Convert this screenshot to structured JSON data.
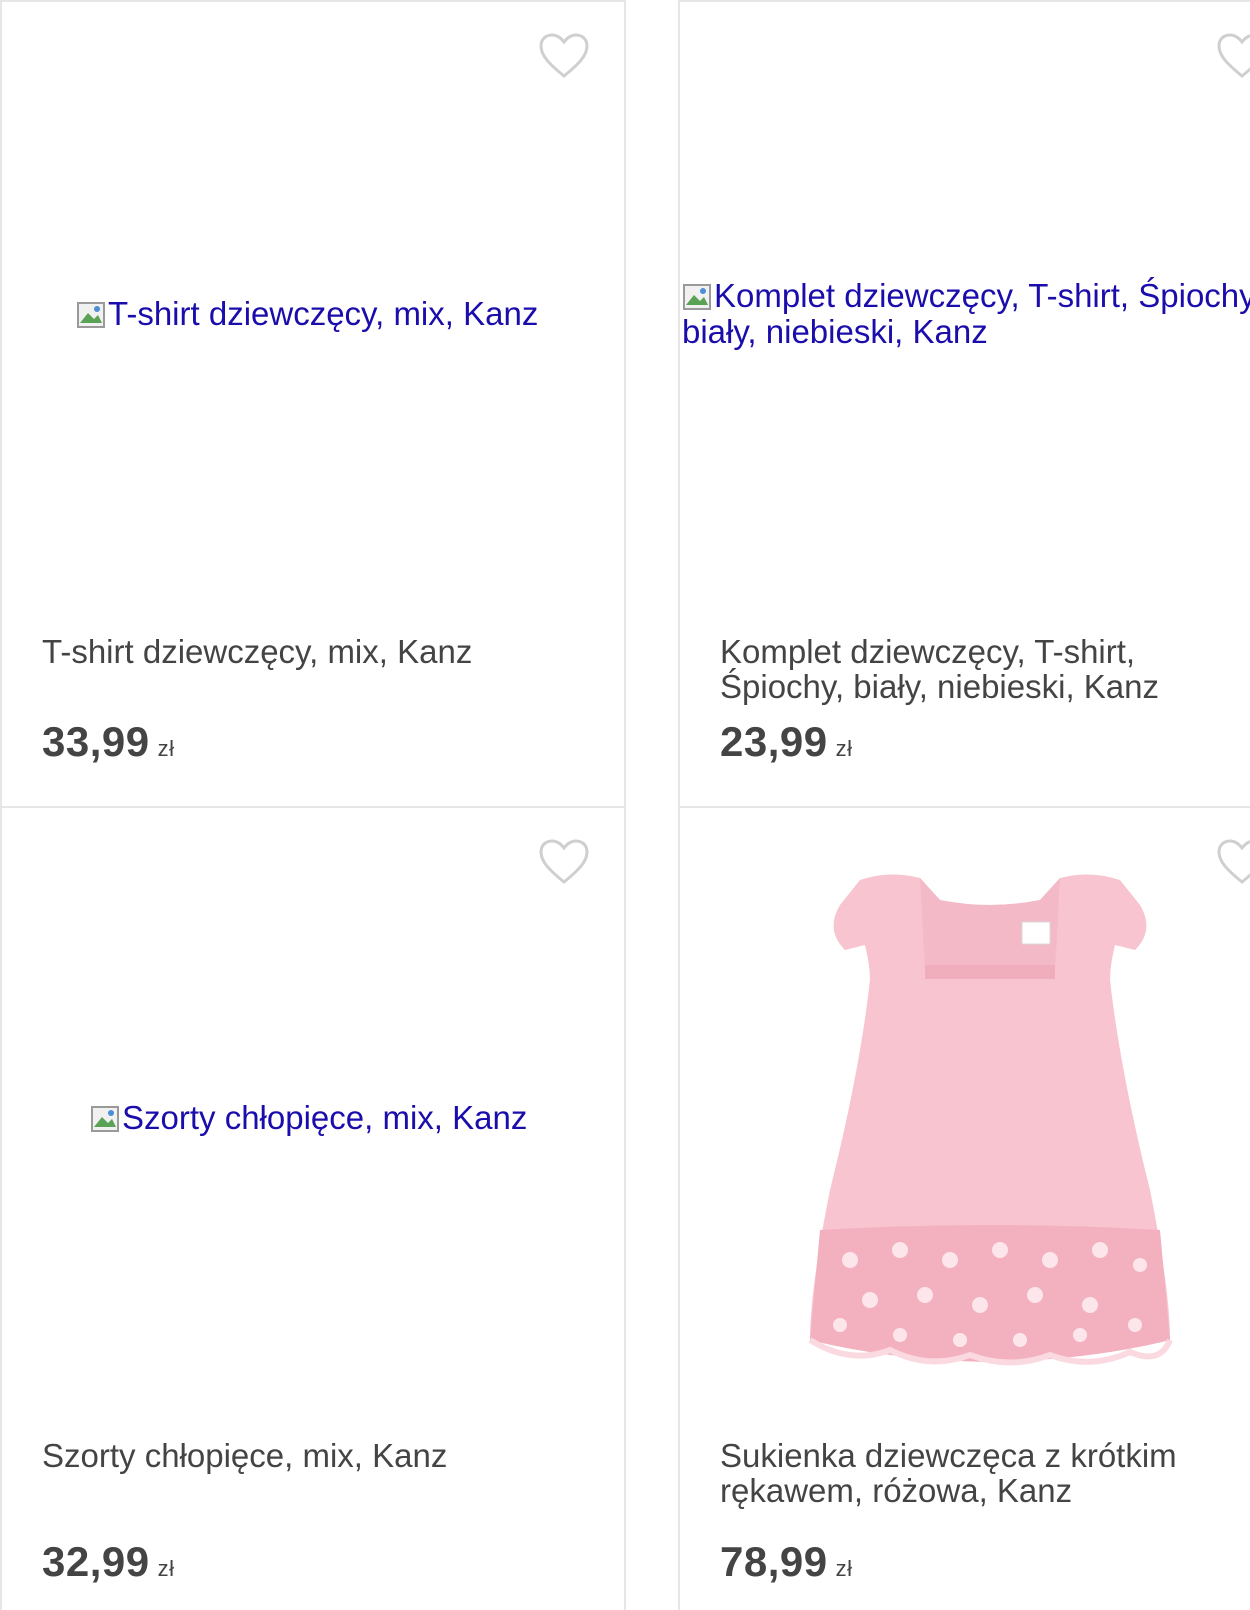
{
  "products": [
    {
      "title": "T-shirt dziewczęcy, mix, Kanz",
      "image_alt": "T-shirt dziewczęcy, mix, Kanz",
      "price": "33,99",
      "currency": "zł"
    },
    {
      "title": "Komplet dziewczęcy, T-shirt, Śpiochy, biały, niebieski, Kanz",
      "image_alt": "Komplet dziewczęcy, T-shirt, Śpiochy, biały, niebieski, Kanz",
      "price": "23,99",
      "currency": "zł"
    },
    {
      "title": "Szorty chłopięce, mix, Kanz",
      "image_alt": "Szorty chłopięce, mix, Kanz",
      "price": "32,99",
      "currency": "zł"
    },
    {
      "title": "Sukienka dziewczęca z krótkim rękawem, różowa, Kanz",
      "image_alt": "",
      "price": "78,99",
      "currency": "zł"
    }
  ],
  "icons": {
    "favorite": "heart-outline-icon",
    "broken_image": "broken-image-icon"
  },
  "colors": {
    "text": "#444444",
    "link": "#1a0dab",
    "border": "#e6e6e6",
    "heart": "#cfcfcf",
    "dress": "#f7c4cf"
  }
}
